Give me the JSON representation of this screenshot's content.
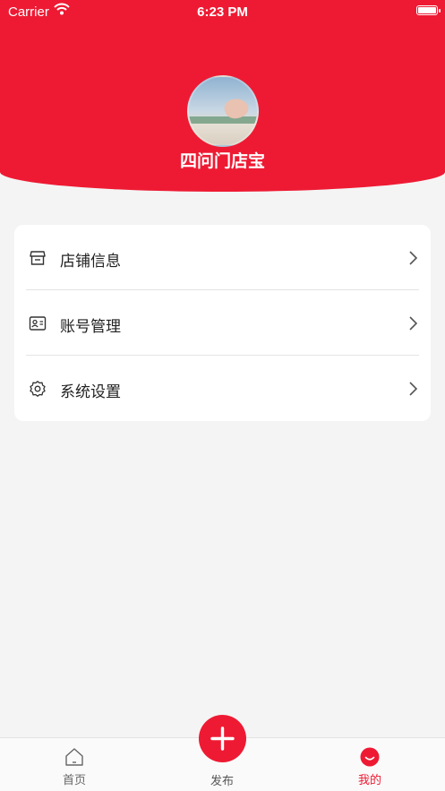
{
  "status_bar": {
    "carrier": "Carrier",
    "time": "6:23 PM"
  },
  "profile": {
    "shop_name": "四问门店宝"
  },
  "menu": [
    {
      "label": "店铺信息",
      "icon": "store-icon"
    },
    {
      "label": "账号管理",
      "icon": "id-card-icon"
    },
    {
      "label": "系统设置",
      "icon": "gear-icon"
    }
  ],
  "tabbar": {
    "home": "首页",
    "publish": "发布",
    "mine": "我的"
  },
  "colors": {
    "brand": "#ee1a33",
    "background": "#f4f4f4"
  }
}
